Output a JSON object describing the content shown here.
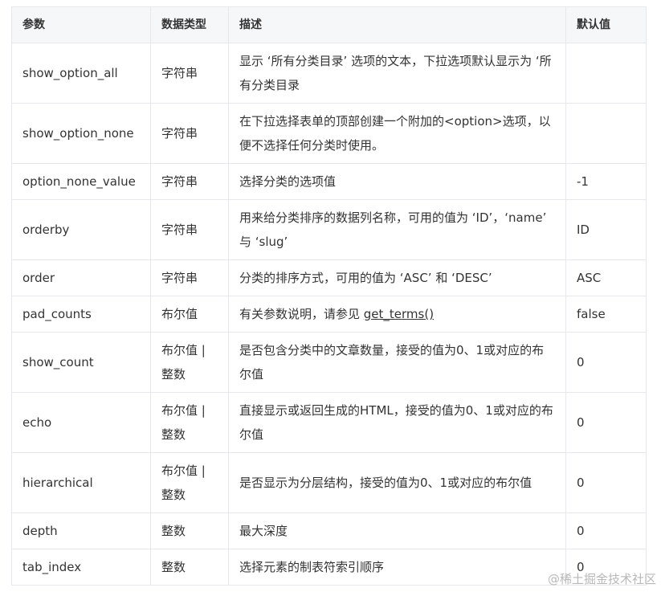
{
  "table": {
    "headers": [
      "参数",
      "数据类型",
      "描述",
      "默认值"
    ],
    "rows": [
      {
        "param": "show_option_all",
        "type": "字符串",
        "desc": "显示 ‘所有分类目录’ 选项的文本，下拉选项默认显示为 ‘所有分类目录",
        "default": ""
      },
      {
        "param": "show_option_none",
        "type": "字符串",
        "desc": "在下拉选择表单的顶部创建一个附加的<option>选项，以便不选择任何分类时使用。",
        "default": ""
      },
      {
        "param": "option_none_value",
        "type": "字符串",
        "desc": "选择分类的选项值",
        "default": "-1"
      },
      {
        "param": "orderby",
        "type": "字符串",
        "desc": "用来给分类排序的数据列名称，可用的值为 ‘ID’，‘name’ 与 ‘slug’",
        "default": "ID"
      },
      {
        "param": "order",
        "type": "字符串",
        "desc": "分类的排序方式，可用的值为 ‘ASC’ 和 ‘DESC’",
        "default": "ASC"
      },
      {
        "param": "pad_counts",
        "type": "布尔值",
        "desc_prefix": "有关参数说明，请参见 ",
        "desc_link": "get_terms()",
        "default": "false"
      },
      {
        "param": "show_count",
        "type": "布尔值 | 整数",
        "desc": "是否包含分类中的文章数量，接受的值为0、1或对应的布尔值",
        "default": "0"
      },
      {
        "param": "echo",
        "type": "布尔值 | 整数",
        "desc": "直接显示或返回生成的HTML，接受的值为0、1或对应的布尔值",
        "default": "0"
      },
      {
        "param": "hierarchical",
        "type": "布尔值 | 整数",
        "desc": "是否显示为分层结构，接受的值为0、1或对应的布尔值",
        "default": "0"
      },
      {
        "param": "depth",
        "type": "整数",
        "desc": "最大深度",
        "default": "0"
      },
      {
        "param": "tab_index",
        "type": "整数",
        "desc": "选择元素的制表符索引顺序",
        "default": "0"
      }
    ]
  },
  "watermark": "@稀土掘金技术社区"
}
